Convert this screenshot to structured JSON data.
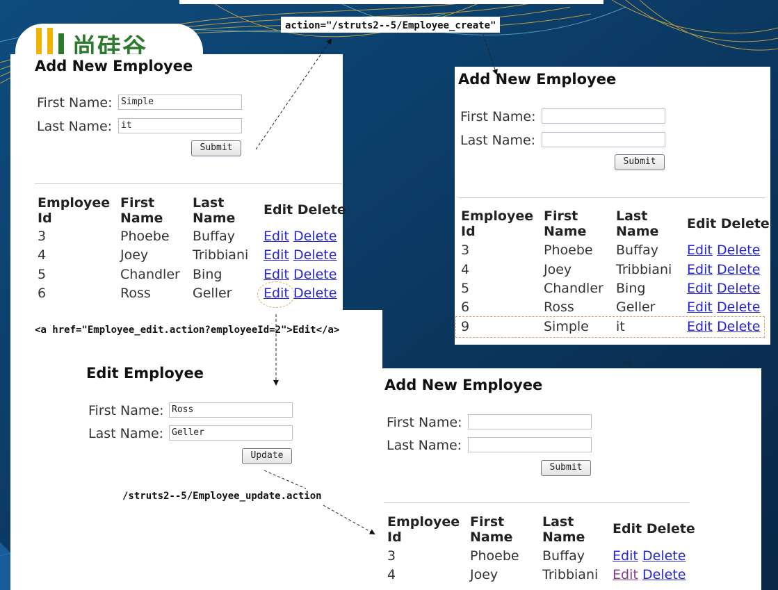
{
  "colors": {
    "background": "#0b2f5a",
    "link": "#2424d8",
    "visited_link": "#8a3a8a",
    "highlight": "#e7a060",
    "logo_green": "#2c7a2c",
    "logo_yellow": "#f0b400"
  },
  "logo": {
    "text": "尚硅谷"
  },
  "annotations": {
    "create_action": "action=\"/struts2--5/Employee_create\"",
    "edit_link": "<a href=\"Employee_edit.action?employeeId=2\">Edit</a>",
    "update_action": "/struts2--5/Employee_update.action"
  },
  "form_labels": {
    "first_name": "First Name:",
    "last_name": "Last Name:"
  },
  "table_headers": {
    "id": "Employee Id",
    "first": "First Name",
    "last": "Last Name",
    "actions": "Edit Delete"
  },
  "link_labels": {
    "edit": "Edit",
    "delete": "Delete"
  },
  "panel1": {
    "heading": "Add New Employee",
    "first_value": "Simple",
    "last_value": "it",
    "button": "Submit",
    "rows": [
      {
        "id": "3",
        "first": "Phoebe",
        "last": "Buffay"
      },
      {
        "id": "4",
        "first": "Joey",
        "last": "Tribbiani"
      },
      {
        "id": "5",
        "first": "Chandler",
        "last": "Bing"
      },
      {
        "id": "6",
        "first": "Ross",
        "last": "Geller"
      }
    ]
  },
  "panel2": {
    "heading": "Add New Employee",
    "first_value": "",
    "last_value": "",
    "button": "Submit",
    "rows": [
      {
        "id": "3",
        "first": "Phoebe",
        "last": "Buffay"
      },
      {
        "id": "4",
        "first": "Joey",
        "last": "Tribbiani"
      },
      {
        "id": "5",
        "first": "Chandler",
        "last": "Bing"
      },
      {
        "id": "6",
        "first": "Ross",
        "last": "Geller"
      },
      {
        "id": "9",
        "first": "Simple",
        "last": "it"
      }
    ]
  },
  "edit_panel": {
    "heading": "Edit Employee",
    "first_value": "Ross",
    "last_value": "Geller",
    "button": "Update"
  },
  "panel3": {
    "heading": "Add New Employee",
    "first_value": "",
    "last_value": "",
    "button": "Submit",
    "rows": [
      {
        "id": "3",
        "first": "Phoebe",
        "last": "Buffay"
      },
      {
        "id": "4",
        "first": "Joey",
        "last": "Tribbiani"
      }
    ]
  }
}
